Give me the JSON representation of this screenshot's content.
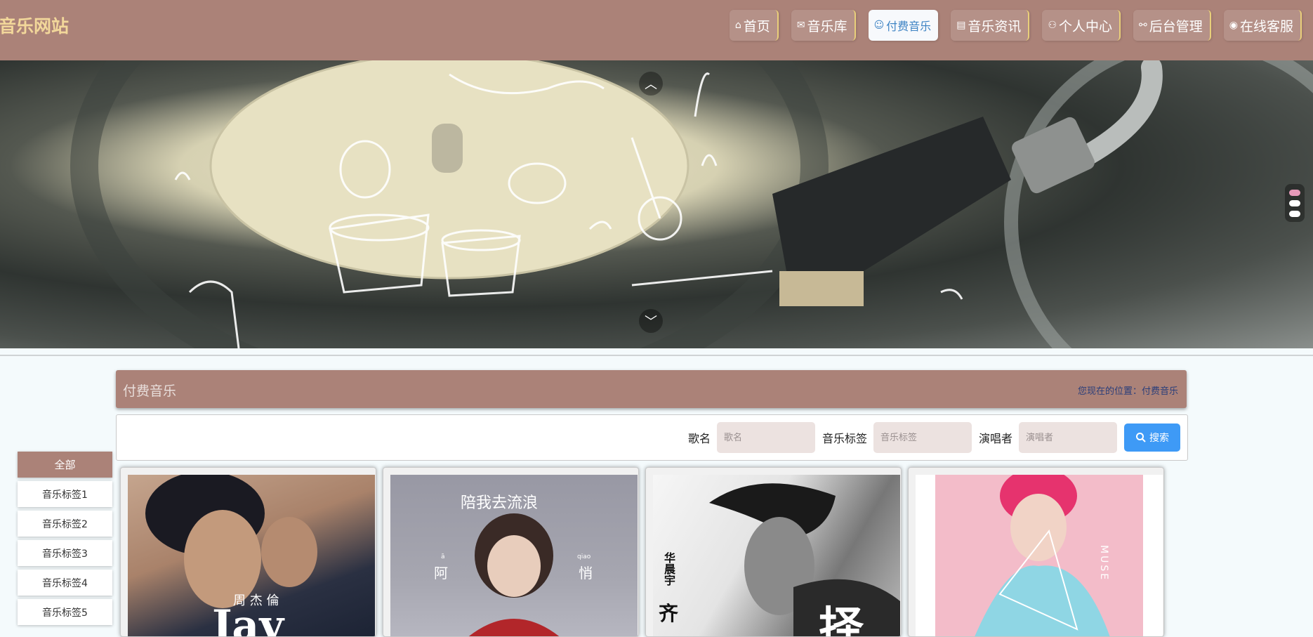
{
  "site": {
    "logo": "音乐网站"
  },
  "nav": {
    "items": [
      {
        "label": "首页",
        "icon": "⌂"
      },
      {
        "label": "音乐库",
        "icon": "✉"
      },
      {
        "label": "付费音乐",
        "icon": "☺"
      },
      {
        "label": "音乐资讯",
        "icon": "▤"
      },
      {
        "label": "个人中心",
        "icon": "⚇"
      },
      {
        "label": "后台管理",
        "icon": "⚯"
      },
      {
        "label": "在线客服",
        "icon": "◉"
      }
    ],
    "active_index": 2
  },
  "banner": {
    "up_arrow": "︿",
    "down_arrow": "﹀",
    "slides": 3,
    "active_slide": 0
  },
  "page": {
    "title": "付费音乐",
    "breadcrumb": "您现在的位置：付费音乐"
  },
  "search": {
    "song_label": "歌名",
    "song_placeholder": "歌名",
    "tag_label": "音乐标签",
    "tag_placeholder": "音乐标签",
    "singer_label": "演唱者",
    "singer_placeholder": "演唱者",
    "button_label": "搜索"
  },
  "sidebar": {
    "items": [
      {
        "label": "全部"
      },
      {
        "label": "音乐标签1"
      },
      {
        "label": "音乐标签2"
      },
      {
        "label": "音乐标签3"
      },
      {
        "label": "音乐标签4"
      },
      {
        "label": "音乐标签5"
      }
    ]
  },
  "cards": [
    {
      "cover_text_main": "Jay",
      "cover_text_sub": "周 杰 倫"
    },
    {
      "cover_text_top": "陪我去流浪",
      "cover_text_left": "阿",
      "cover_text_right": "悄",
      "pinyin_left": "ā",
      "pinyin_right": "qiao"
    },
    {
      "cover_text_side": "华晨宇",
      "cover_text_bottom": "齐",
      "cover_text_big": "择"
    },
    {
      "cover_text_side": "MUSE"
    }
  ],
  "colors": {
    "header_bg": "#ab8278",
    "logo": "#f2d79a",
    "nav_active_text": "#3f84c4",
    "search_button": "#3e9af6",
    "dot_active": "#e79ab9"
  }
}
